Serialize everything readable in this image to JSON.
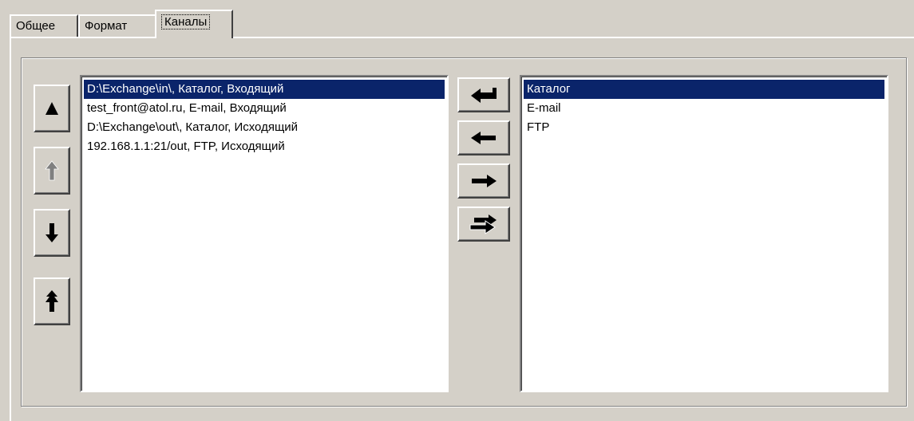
{
  "tabs": [
    {
      "label": "Общее"
    },
    {
      "label": "Формат"
    },
    {
      "label": "Каналы"
    }
  ],
  "active_tab": "Каналы",
  "order_buttons": [
    {
      "icon": "arrow-up-icon",
      "enabled": true
    },
    {
      "icon": "arrow-up-icon",
      "enabled": false
    },
    {
      "icon": "arrow-down-icon",
      "enabled": true
    },
    {
      "icon": "arrow-up-double-icon",
      "enabled": true
    }
  ],
  "transfer_buttons": [
    {
      "icon": "return-arrow-icon"
    },
    {
      "icon": "arrow-left-icon"
    },
    {
      "icon": "arrow-right-icon"
    },
    {
      "icon": "double-arrow-right-icon"
    }
  ],
  "channels_list": {
    "items": [
      "D:\\Exchange\\in\\, Каталог, Входящий",
      "test_front@atol.ru, E-mail, Входящий",
      "D:\\Exchange\\out\\, Каталог, Исходящий",
      "192.168.1.1:21/out, FTP, Исходящий"
    ],
    "selected_index": 0
  },
  "types_list": {
    "items": [
      "Каталог",
      "E-mail",
      "FTP"
    ],
    "selected_index": 0
  },
  "colors": {
    "window_bg": "#d4d0c8",
    "selection_bg": "#0a246a",
    "disabled": "#808080"
  }
}
